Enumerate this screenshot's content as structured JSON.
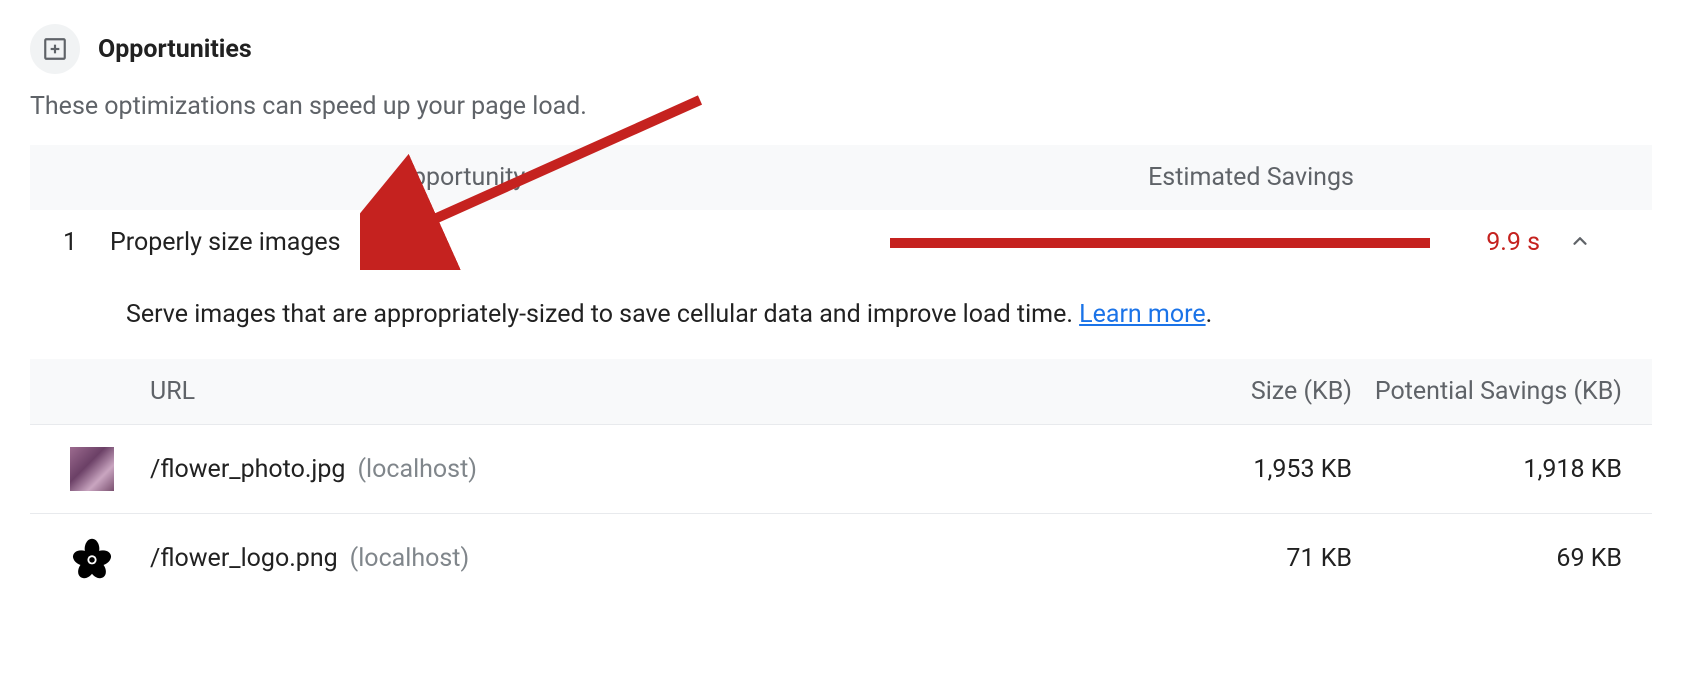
{
  "section": {
    "title": "Opportunities",
    "subtitle": "These optimizations can speed up your page load."
  },
  "table": {
    "header_opportunity": "Opportunity",
    "header_savings": "Estimated Savings"
  },
  "opportunity": {
    "index": "1",
    "title": "Properly size images",
    "savings_time": "9.9 s",
    "description_prefix": "Serve images that are appropriately-sized to save cellular data and improve load time. ",
    "learn_more": "Learn more",
    "description_suffix": "."
  },
  "details": {
    "header_url": "URL",
    "header_size": "Size (KB)",
    "header_savings": "Potential Savings (KB)",
    "rows": [
      {
        "path": "/flower_photo.jpg",
        "host": "(localhost)",
        "size": "1,953 KB",
        "savings": "1,918 KB",
        "thumb": "photo"
      },
      {
        "path": "/flower_logo.png",
        "host": "(localhost)",
        "size": "71 KB",
        "savings": "69 KB",
        "thumb": "logo"
      }
    ]
  }
}
